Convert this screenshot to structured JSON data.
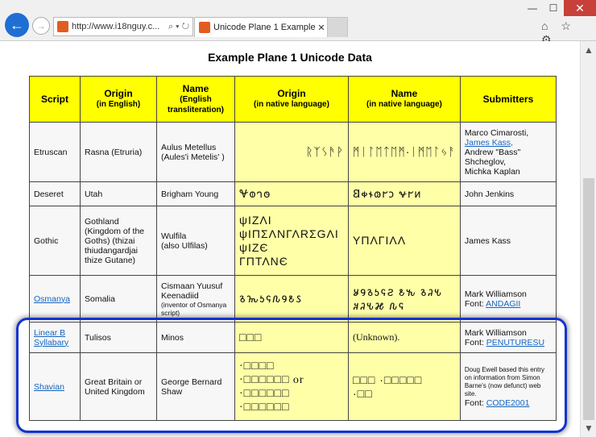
{
  "browser": {
    "address": "http://www.i18nguy.c...",
    "address_icons": "⌕ ▾ ↻",
    "tab_title": "Unicode Plane 1 Example U...",
    "tab_close": "✕",
    "win_min": "—",
    "win_max": "☐",
    "win_close": "✕",
    "back_icon": "←",
    "forward_icon": "→",
    "tool_icons": "⌂ ☆ ⚙"
  },
  "page": {
    "title": "Example Plane 1 Unicode Data",
    "headers": {
      "script": "Script",
      "origin_en": "Origin",
      "origin_en_sub": "(in English)",
      "name_en": "Name",
      "name_en_sub": "(English transliteration)",
      "origin_native": "Origin",
      "origin_native_sub": "(in native language)",
      "name_native": "Name",
      "name_native_sub": "(in native language)",
      "submitters": "Submitters"
    },
    "rows": [
      {
        "script": "Etruscan",
        "origin": "Rasna (Etruria)",
        "name": "Aulus Metellus (Aules'i Metelis' )",
        "origin_native": "ᚱᛉᛊᚫᚹ",
        "name_native": "ᛗᛁᛚᛖᛏᛖᛗ·ᛁᛗᛖᛚᛃᚨ",
        "submitters_1": "Marco Cimarosti,",
        "submitters_link": "James Kass,",
        "submitters_2": "Andrew \"Bass\" Shcheglov,",
        "submitters_3": "Michka Kaplan"
      },
      {
        "script": "Deseret",
        "origin": "Utah",
        "name": "Brigham Young",
        "origin_native": "𐐏𐐭𐐻𐐫",
        "name_native": "𐐒𐑉𐐮𐑀𐐲𐑋 𐐷𐐲𐑍",
        "submitters": "John Jenkins"
      },
      {
        "script": "Gothic",
        "origin": "Gothland (Kingdom of the Goths) (thizai thiudangardjai thize Gutane)",
        "name_1": "Wulfila",
        "name_2": "(also Ulfilas)",
        "origin_native_1": "ψΙΖΛΙ",
        "origin_native_2": "ψΙΠΣΛΝΓΛRΣGΛΙ",
        "origin_native_3": "ψΙΖЄ",
        "origin_native_4": "ΓΠΤΛΝЄ",
        "name_native": "ΥΠΛΓΙΛΛ",
        "submitters": "James Kass"
      },
      {
        "script": "Osmanya",
        "origin": "Somalia",
        "name_1": "Cismaan Yuusuf Keenadiid",
        "name_2": "(inventor of Osmanya script)",
        "origin_native": "𐒈𐒝𐒑𐒛𐒐𐒘𐒕𐒖",
        "name_native_1": "𐒋𐒘𐒈𐒑𐒛𐒒 𐒕𐒓 𐒈𐒚𐒍",
        "name_native_2": "𐒏𐒚𐒍𐒎 𐒐𐒛",
        "submitters_1": "Mark Williamson",
        "font_label": "Font:",
        "font_link": "ANDAGII"
      },
      {
        "script": "Linear B Syllabary",
        "origin": "Tulisos",
        "name": "Minos",
        "origin_native": "□□□",
        "name_native": "(Unknown).",
        "submitters_1": "Mark Williamson",
        "font_label": "Font:",
        "font_link": "PENUTURESU"
      },
      {
        "script": "Shavian",
        "origin": "Great Britain or United Kingdom",
        "name": "George Bernard Shaw",
        "origin_native_1": "·□□□□",
        "origin_native_2": "·□□□□□□ or",
        "origin_native_3": "·□□□□□□",
        "origin_native_4": "·□□□□□□",
        "name_native_1": "□□□ ·□□□□□",
        "name_native_2": "·□□",
        "submitters_note": "Doug Ewell based this entry on information from Simon Barne's (now defunct) web site.",
        "font_label": "Font:",
        "font_link": "CODE2001"
      }
    ]
  },
  "scroll": {
    "up": "▲",
    "down": "▼"
  },
  "colors": {
    "header_bg": "#ffff00",
    "native_bg": "#ffffa8",
    "highlight": "#1432d0",
    "accent": "#1f6ed4"
  }
}
